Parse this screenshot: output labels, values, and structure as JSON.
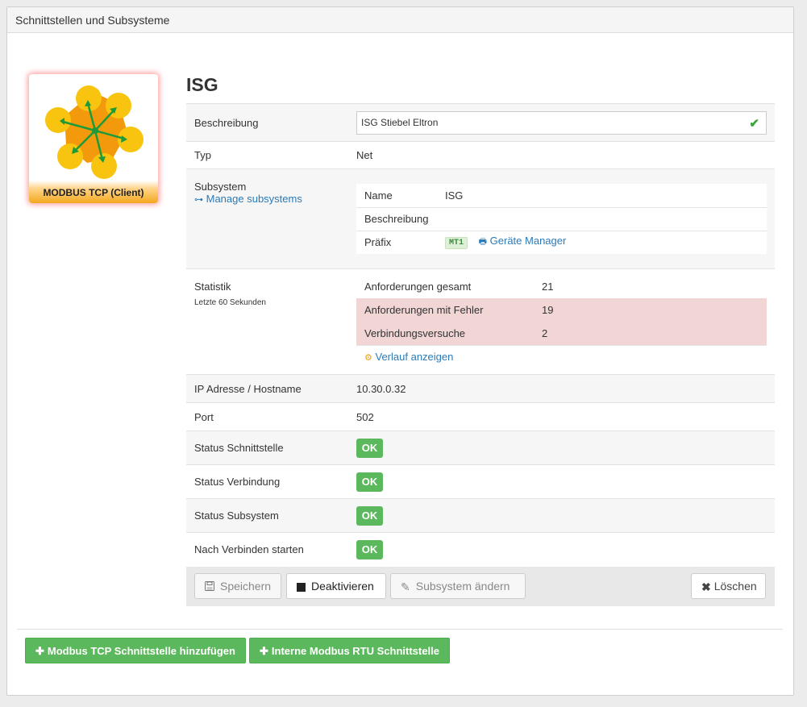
{
  "panel": {
    "title": "Schnittstellen und Subsysteme"
  },
  "module": {
    "label": "MODBUS TCP (Client)",
    "icon": "modbus-network-icon"
  },
  "device": {
    "name": "ISG",
    "rows": {
      "description_label": "Beschreibung",
      "description_value": "ISG Stiebel Eltron",
      "type_label": "Typ",
      "type_value": "Net",
      "subsystem_label": "Subsystem",
      "manage_link": "Manage subsystems",
      "subsystem": {
        "name_label": "Name",
        "name_value": "ISG",
        "desc_label": "Beschreibung",
        "desc_value": "",
        "prefix_label": "Präfix",
        "prefix_value": "MT1",
        "manager_link": "Geräte Manager"
      },
      "stats_label": "Statistik",
      "stats_sublabel": "Letzte 60 Sekunden",
      "stats": {
        "total_label": "Anforderungen gesamt",
        "total_value": "21",
        "errors_label": "Anforderungen mit Fehler",
        "errors_value": "19",
        "attempts_label": "Verbindungsversuche",
        "attempts_value": "2",
        "history_link": "Verlauf anzeigen"
      },
      "ip_label": "IP Adresse / Hostname",
      "ip_value": "10.30.0.32",
      "port_label": "Port",
      "port_value": "502",
      "status_interface_label": "Status Schnittstelle",
      "status_interface_value": "OK",
      "status_connection_label": "Status Verbindung",
      "status_connection_value": "OK",
      "status_subsystem_label": "Status Subsystem",
      "status_subsystem_value": "OK",
      "start_after_label": "Nach Verbinden starten",
      "start_after_value": "OK"
    }
  },
  "toolbar": {
    "save": "Speichern",
    "deactivate": "Deaktivieren",
    "change_subsystem": "Subsystem ändern",
    "delete": "Löschen"
  },
  "footer": {
    "add_tcp": "Modbus TCP Schnittstelle hinzufügen",
    "add_rtu": "Interne Modbus RTU Schnittstelle"
  },
  "colors": {
    "ok_green": "#5cb85c",
    "danger_row": "#f2d5d5",
    "link_blue": "#2a7ab8",
    "accent_orange": "#f3a81f"
  }
}
